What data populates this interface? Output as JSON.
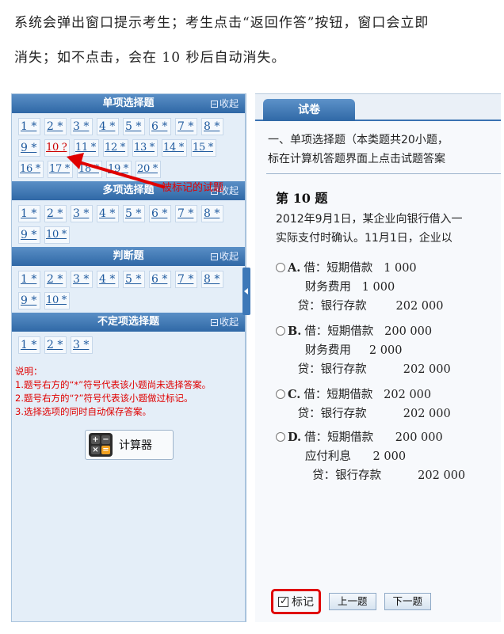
{
  "intro": {
    "line1": "系统会弹出窗口提示考生；考生点击“返回作答”按钮，窗口会立即",
    "line2": "消失；如不点击，会在 10 秒后自动消失。"
  },
  "left_panel": {
    "collapse_label": "收起",
    "sections": [
      {
        "title": "单项选择题",
        "items": [
          "1 *",
          "2 *",
          "3 *",
          "4 *",
          "5 *",
          "6 *",
          "7 *",
          "8 *",
          "9 *",
          "10 ?",
          "11 *",
          "12 *",
          "13 *",
          "14 *",
          "15 *",
          "16 *",
          "17 *",
          "18 *",
          "19 *",
          "20 *"
        ]
      },
      {
        "title": "多项选择题",
        "items": [
          "1 *",
          "2 *",
          "3 *",
          "4 *",
          "5 *",
          "6 *",
          "7 *",
          "8 *",
          "9 *",
          "10 *"
        ]
      },
      {
        "title": "判断题",
        "items": [
          "1 *",
          "2 *",
          "3 *",
          "4 *",
          "5 *",
          "6 *",
          "7 *",
          "8 *",
          "9 *",
          "10 *"
        ]
      },
      {
        "title": "不定项选择题",
        "items": [
          "1 *",
          "2 *",
          "3 *"
        ]
      }
    ],
    "notes": {
      "heading": "说明：",
      "n1": "1.题号右方的“*”符号代表该小题尚未选择答案。",
      "n2": "2.题号右方的“?”符号代表该小题做过标记。",
      "n3": "3.选择选项的同时自动保存答案。"
    },
    "calculator_label": "计算器"
  },
  "annotation": {
    "text": "被标记的试题"
  },
  "right_panel": {
    "tab_label": "试卷",
    "instruction_line1": "一、单项选择题（本类题共20小题，",
    "instruction_line2": "标在计算机答题界面上点击试题答案",
    "question_title": "第 10 题",
    "stem_line1": "2012年9月1日，某企业向银行借入一",
    "stem_line2": "实际支付时确认。11月1日，企业以",
    "options": [
      {
        "letter": "A.",
        "rows": [
          "借：短期借款   1 000",
          "        财务费用   1 000",
          "      贷：银行存款        202 000"
        ]
      },
      {
        "letter": "B.",
        "rows": [
          "借：短期借款   200 000",
          "        财务费用     2 000",
          "      贷：银行存款          202 000"
        ]
      },
      {
        "letter": "C.",
        "rows": [
          "借：短期借款   202 000",
          "      贷：银行存款          202 000"
        ]
      },
      {
        "letter": "D.",
        "rows": [
          "借：短期借款      200 000",
          "        应付利息      2 000",
          "          贷：银行存款          202 000"
        ]
      }
    ],
    "mark_label": "标记",
    "prev_label": "上一题",
    "next_label": "下一题"
  }
}
